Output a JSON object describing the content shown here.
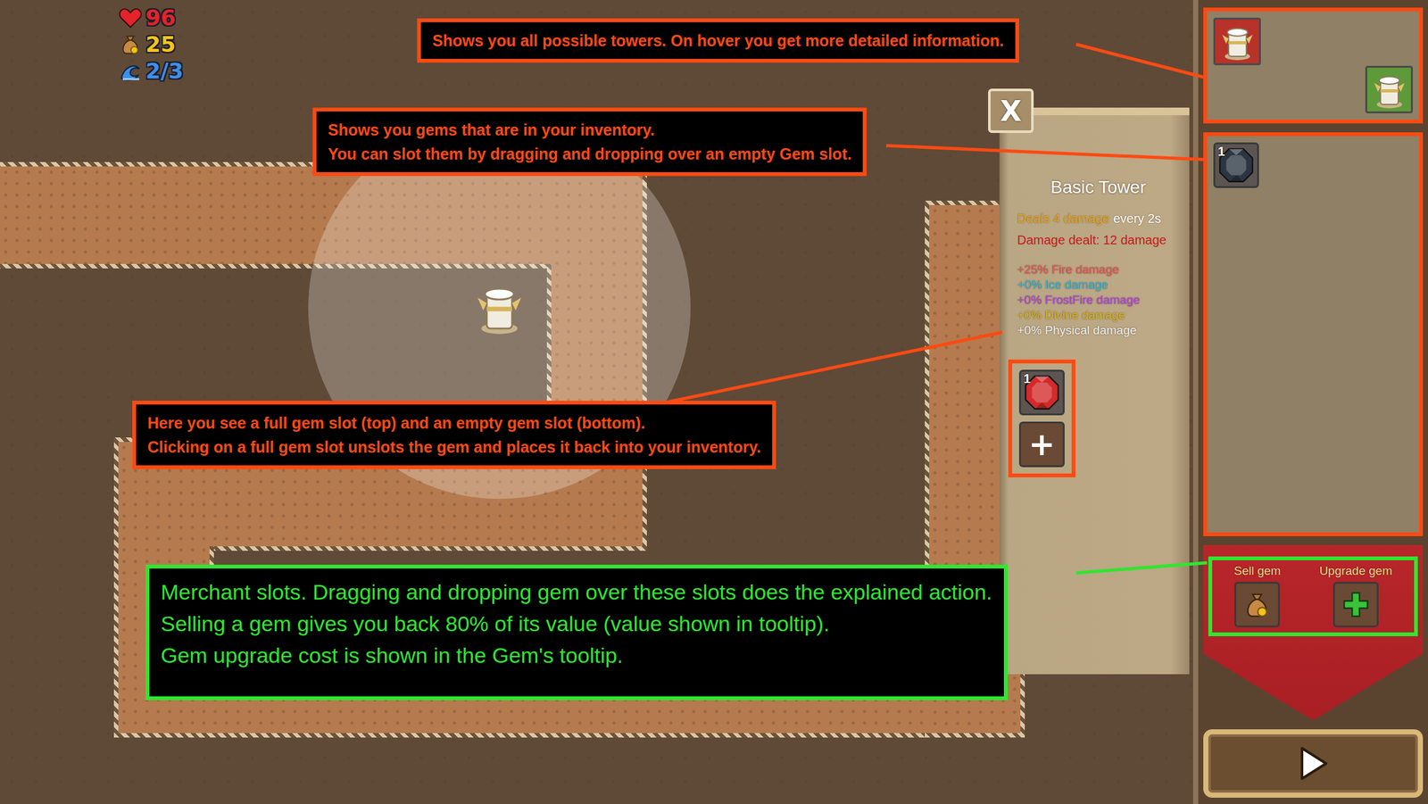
{
  "stats": [
    {
      "kind": "health",
      "value": "96",
      "color": "#e3242b"
    },
    {
      "kind": "gold",
      "value": "25",
      "color": "#f5c518"
    },
    {
      "kind": "wave",
      "value": "2/3",
      "color": "#3d8fe6"
    }
  ],
  "tower_info": {
    "close": "X",
    "title": "Basic Tower",
    "damage": "Deals 4 damage",
    "interval": "every 2s",
    "damage_dealt": "Damage dealt: 12 damage",
    "bonuses": [
      {
        "text": "+25% Fire damage",
        "color": "#e8585a"
      },
      {
        "text": "+0% Ice damage",
        "color": "#2fb8d8"
      },
      {
        "text": "+0% FrostFire damage",
        "color": "#b444e0"
      },
      {
        "text": "+0% Divine damage",
        "color": "#d9b424"
      },
      {
        "text": "+0% Physical damage",
        "color": "#f2f2f2"
      }
    ],
    "gem_slots": [
      {
        "kind": "full",
        "count": "1",
        "color": "#d42a2a"
      },
      {
        "kind": "empty",
        "label": "+"
      }
    ]
  },
  "towers": [
    {
      "color": "#b8322a"
    },
    {
      "color": "#5e9a3a"
    }
  ],
  "inventory": [
    {
      "count": "1",
      "color": "#2c3642"
    }
  ],
  "merchant": [
    {
      "kind": "sell",
      "label": "Sell gem"
    },
    {
      "kind": "upgrade",
      "label": "Upgrade gem"
    }
  ],
  "annotations": [
    {
      "kind": "callout",
      "color": "#ff4a12",
      "lines": [
        "Shows you all possible towers. On hover you get more detailed information."
      ]
    },
    {
      "kind": "callout",
      "color": "#ff4a12",
      "lines": [
        "Shows you gems that are in your inventory.",
        "You can slot them by dragging and dropping over an empty Gem slot."
      ]
    },
    {
      "kind": "callout",
      "color": "#ff4a12",
      "lines": [
        "Here you see a full gem slot (top) and an empty gem slot (bottom).",
        "Clicking on a full gem slot unslots the gem and places it back into your inventory."
      ]
    },
    {
      "kind": "note",
      "color": "#2fe62f",
      "lines": [
        "Merchant slots. Dragging and dropping gem over these slots does the explained action.",
        "Selling a gem gives you back 80% of its value (value shown in tooltip).",
        "Gem upgrade cost is shown in the Gem's tooltip."
      ]
    }
  ]
}
